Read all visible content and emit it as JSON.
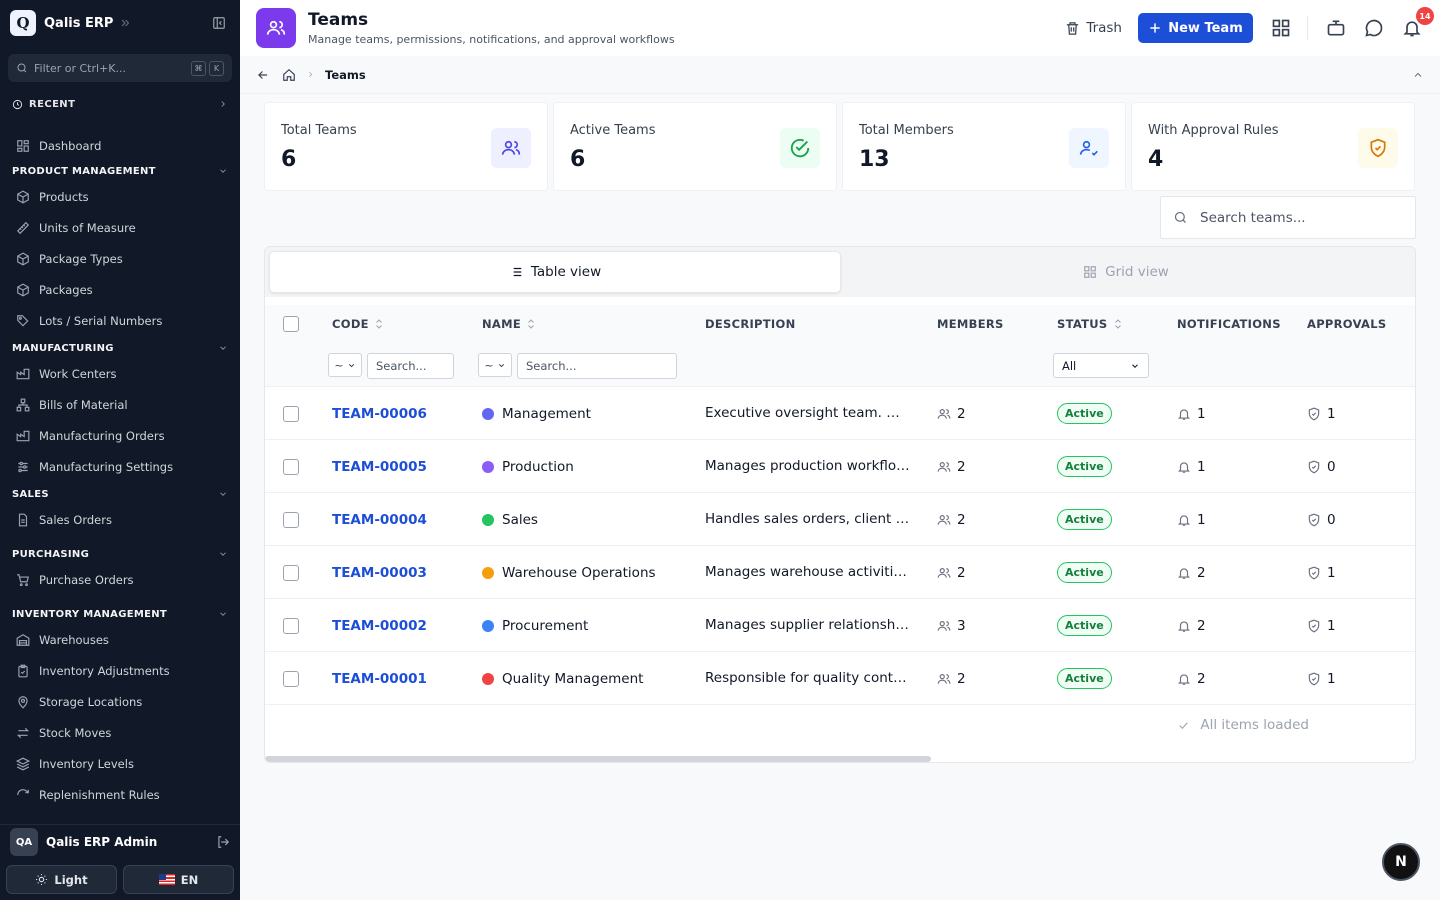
{
  "app": {
    "logo_letter": "Q",
    "name": "Qalis ERP"
  },
  "sidebar": {
    "filter_placeholder": "Filter or Ctrl+K...",
    "kbd1": "⌘",
    "kbd2": "K",
    "recent_label": "RECENT",
    "dashboard": "Dashboard",
    "sections": [
      {
        "title": "PRODUCT MANAGEMENT",
        "items": [
          "Products",
          "Units of Measure",
          "Package Types",
          "Packages",
          "Lots / Serial Numbers"
        ]
      },
      {
        "title": "MANUFACTURING",
        "items": [
          "Work Centers",
          "Bills of Material",
          "Manufacturing Orders",
          "Manufacturing Settings"
        ]
      },
      {
        "title": "SALES",
        "items": [
          "Sales Orders"
        ]
      },
      {
        "title": "PURCHASING",
        "items": [
          "Purchase Orders"
        ]
      },
      {
        "title": "INVENTORY MANAGEMENT",
        "items": [
          "Warehouses",
          "Inventory Adjustments",
          "Storage Locations",
          "Stock Moves",
          "Inventory Levels",
          "Replenishment Rules"
        ]
      }
    ],
    "user": {
      "initials": "QA",
      "name": "Qalis ERP Admin"
    },
    "theme_label": "Light",
    "lang_label": "EN"
  },
  "header": {
    "title": "Teams",
    "subtitle": "Manage teams, permissions, notifications, and approval workflows",
    "trash_label": "Trash",
    "new_team_label": "New Team",
    "notification_count": "14"
  },
  "breadcrumb": {
    "current": "Teams"
  },
  "stats": [
    {
      "label": "Total Teams",
      "value": "6",
      "icon": "users-icon",
      "bg": "#eef0ff",
      "color": "#4f46e5"
    },
    {
      "label": "Active Teams",
      "value": "6",
      "icon": "check-circle-icon",
      "bg": "#ecfdf3",
      "color": "#16a34a"
    },
    {
      "label": "Total Members",
      "value": "13",
      "icon": "user-check-icon",
      "bg": "#eff6ff",
      "color": "#2563eb"
    },
    {
      "label": "With Approval Rules",
      "value": "4",
      "icon": "shield-check-icon",
      "bg": "#fffbeb",
      "color": "#d97706"
    }
  ],
  "search": {
    "placeholder": "Search teams..."
  },
  "view_tabs": {
    "table": "Table view",
    "grid": "Grid view"
  },
  "table": {
    "columns": {
      "code": "CODE",
      "name": "NAME",
      "description": "DESCRIPTION",
      "members": "MEMBERS",
      "status": "STATUS",
      "notifications": "NOTIFICATIONS",
      "approvals": "APPROVALS"
    },
    "filters": {
      "op": "~",
      "search_placeholder": "Search...",
      "status_value": "All"
    },
    "rows": [
      {
        "code": "TEAM-00006",
        "name": "Management",
        "color": "#6366f1",
        "description": "Executive oversight team. Monitors overall operations",
        "members": "2",
        "status": "Active",
        "notifications": "1",
        "approvals": "1"
      },
      {
        "code": "TEAM-00005",
        "name": "Production",
        "color": "#8b5cf6",
        "description": "Manages production workflows and manufacturing",
        "members": "2",
        "status": "Active",
        "notifications": "1",
        "approvals": "0"
      },
      {
        "code": "TEAM-00004",
        "name": "Sales",
        "color": "#22c55e",
        "description": "Handles sales orders, client relationships",
        "members": "2",
        "status": "Active",
        "notifications": "1",
        "approvals": "0"
      },
      {
        "code": "TEAM-00003",
        "name": "Warehouse Operations",
        "color": "#f59e0b",
        "description": "Manages warehouse activities and inventory",
        "members": "2",
        "status": "Active",
        "notifications": "2",
        "approvals": "1"
      },
      {
        "code": "TEAM-00002",
        "name": "Procurement",
        "color": "#3b82f6",
        "description": "Manages supplier relationships and purchasing",
        "members": "3",
        "status": "Active",
        "notifications": "2",
        "approvals": "1"
      },
      {
        "code": "TEAM-00001",
        "name": "Quality Management",
        "color": "#ef4444",
        "description": "Responsible for quality control and inspections",
        "members": "2",
        "status": "Active",
        "notifications": "2",
        "approvals": "1"
      }
    ],
    "footer": "All items loaded"
  },
  "floating": {
    "letter": "N"
  }
}
